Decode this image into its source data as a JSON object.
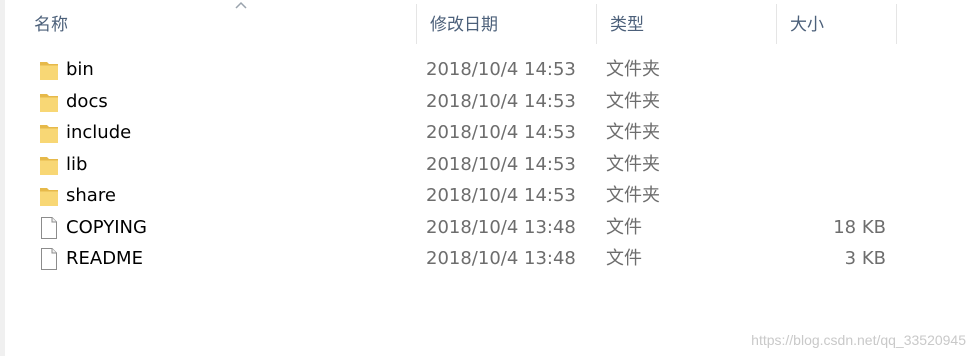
{
  "columns": {
    "name": "名称",
    "date": "修改日期",
    "type": "类型",
    "size": "大小"
  },
  "sort": {
    "column": "name",
    "direction": "ascending",
    "icon": "sort-up-icon"
  },
  "files": [
    {
      "name": "bin",
      "date": "2018/10/4 14:53",
      "type": "文件夹",
      "size": "",
      "icon": "folder-icon"
    },
    {
      "name": "docs",
      "date": "2018/10/4 14:53",
      "type": "文件夹",
      "size": "",
      "icon": "folder-icon"
    },
    {
      "name": "include",
      "date": "2018/10/4 14:53",
      "type": "文件夹",
      "size": "",
      "icon": "folder-icon"
    },
    {
      "name": "lib",
      "date": "2018/10/4 14:53",
      "type": "文件夹",
      "size": "",
      "icon": "folder-icon"
    },
    {
      "name": "share",
      "date": "2018/10/4 14:53",
      "type": "文件夹",
      "size": "",
      "icon": "folder-icon"
    },
    {
      "name": "COPYING",
      "date": "2018/10/4 13:48",
      "type": "文件",
      "size": "18 KB",
      "icon": "file-icon"
    },
    {
      "name": "README",
      "date": "2018/10/4 13:48",
      "type": "文件",
      "size": "3 KB",
      "icon": "file-icon"
    }
  ],
  "watermark": "https://blog.csdn.net/qq_33520945",
  "colors": {
    "header_text": "#4c607a",
    "folder": "#f8d775",
    "folder_dark": "#e6b94a"
  }
}
